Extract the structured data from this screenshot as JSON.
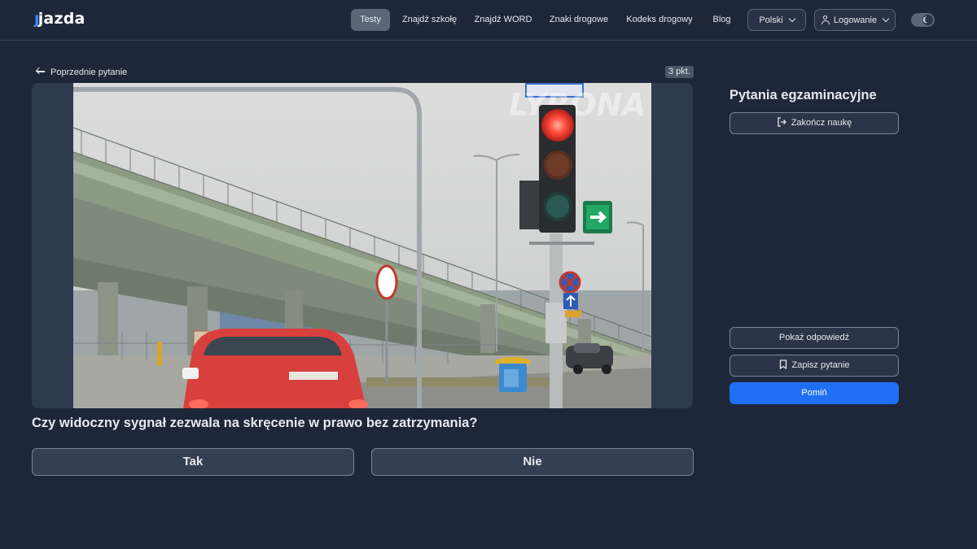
{
  "header": {
    "logo": "jazda",
    "nav": [
      "Testy",
      "Znajdź szkołę",
      "Znajdź WORD",
      "Znaki drogowe",
      "Kodeks drogowy",
      "Blog"
    ],
    "active_nav": "Testy",
    "language": "Polski",
    "login": "Logowanie"
  },
  "main": {
    "prev_label": "Poprzednie pytanie",
    "points": "3 pkt.",
    "watermark": "LYRONA",
    "question": "Czy widoczny sygnał zezwala na skręcenie w prawo bez zatrzymania?",
    "answers": [
      "Tak",
      "Nie"
    ]
  },
  "sidebar": {
    "title": "Pytania egzaminacyjne",
    "end_label": "Zakończ naukę",
    "show_answer": "Pokaż odpowiedź",
    "save_question": "Zapisz pytanie",
    "skip": "Pomiń"
  },
  "colors": {
    "background": "#1e263a",
    "primary": "#1f6ff2",
    "accent_logo": "#3b8cff"
  }
}
